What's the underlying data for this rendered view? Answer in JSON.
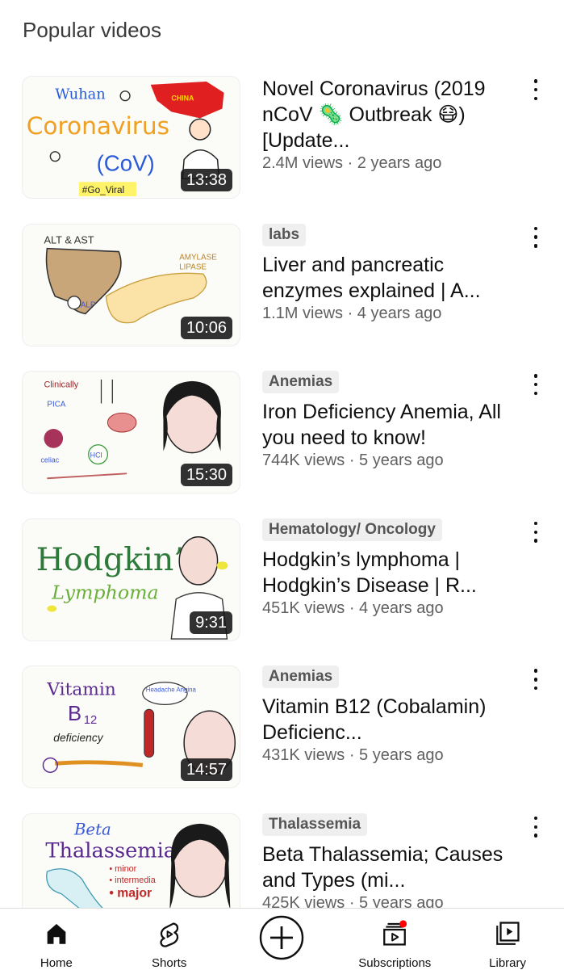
{
  "section": {
    "title": "Popular videos"
  },
  "videos": [
    {
      "title": "Novel Coronavirus (2019 nCoV 🦠 Outbreak 😷) [Update...",
      "meta": "2.4M views · 2 years ago",
      "duration": "13:38",
      "badge": ""
    },
    {
      "title": "Liver and pancreatic enzymes explained | A...",
      "meta": "1.1M views · 4 years ago",
      "duration": "10:06",
      "badge": "labs"
    },
    {
      "title": "Iron Deficiency Anemia, All you need to know!",
      "meta": "744K views · 5 years ago",
      "duration": "15:30",
      "badge": "Anemias"
    },
    {
      "title": "Hodgkin’s lymphoma | Hodgkin’s Disease | R...",
      "meta": "451K views · 4 years ago",
      "duration": "9:31",
      "badge": "Hematology/ Oncology"
    },
    {
      "title": "Vitamin B12 (Cobalamin) Deficienc...",
      "meta": "431K views · 5 years ago",
      "duration": "14:57",
      "badge": "Anemias"
    },
    {
      "title": "Beta Thalassemia; Causes and Types (mi...",
      "meta": "425K views · 5 years ago",
      "duration": "",
      "badge": "Thalassemia"
    }
  ],
  "thumbnails": {
    "t1": {
      "line1": "Wuhan",
      "line2": "Coronavirus",
      "line3": "(CoV)",
      "map": "CHINA",
      "tag": "#Go_Viral"
    },
    "t2": {
      "line1": "ALT & AST",
      "line2": "AMYLASE",
      "line3": "LIPASE",
      "line4": "ALP"
    },
    "t3": {
      "line1": "Clinically",
      "line2": "PICA",
      "line3": "HCl",
      "line4": "celiac"
    },
    "t4": {
      "line1": "Hodgkin’s",
      "line2": "Lymphoma"
    },
    "t5": {
      "line1": "Vitamin",
      "line2": "B",
      "line3": "12",
      "line4": "deficiency",
      "bubble": "Headache Angina"
    },
    "t6": {
      "line1": "Beta",
      "line2": "Thalassemia",
      "line3": "• minor",
      "line4": "• intermedia",
      "line5": "• major"
    }
  },
  "nav": {
    "home": "Home",
    "shorts": "Shorts",
    "subscriptions": "Subscriptions",
    "library": "Library"
  },
  "colors": {
    "notification_dot": "#ff0000",
    "duration_bg": "#141414",
    "badge_bg": "#efefef"
  }
}
